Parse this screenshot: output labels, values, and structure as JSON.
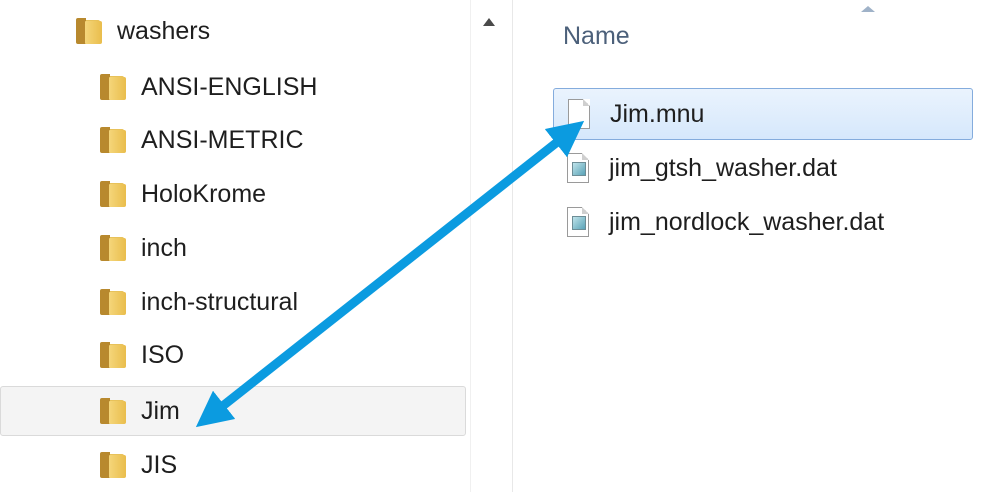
{
  "tree": {
    "items": [
      {
        "label": "washers",
        "selected": false
      },
      {
        "label": "ANSI-ENGLISH",
        "selected": false
      },
      {
        "label": "ANSI-METRIC",
        "selected": false
      },
      {
        "label": "HoloKrome",
        "selected": false
      },
      {
        "label": "inch",
        "selected": false
      },
      {
        "label": "inch-structural",
        "selected": false
      },
      {
        "label": "ISO",
        "selected": false
      },
      {
        "label": "Jim",
        "selected": true
      },
      {
        "label": "JIS",
        "selected": false
      }
    ]
  },
  "files": {
    "column_header": "Name",
    "rows": [
      {
        "name": "Jim.mnu",
        "icon": "blank-file-icon",
        "selected": true
      },
      {
        "name": "jim_gtsh_washer.dat",
        "icon": "dat-file-icon",
        "selected": false
      },
      {
        "name": "jim_nordlock_washer.dat",
        "icon": "dat-file-icon",
        "selected": false
      }
    ]
  },
  "annotation": {
    "arrow_color": "#0b9be0"
  }
}
